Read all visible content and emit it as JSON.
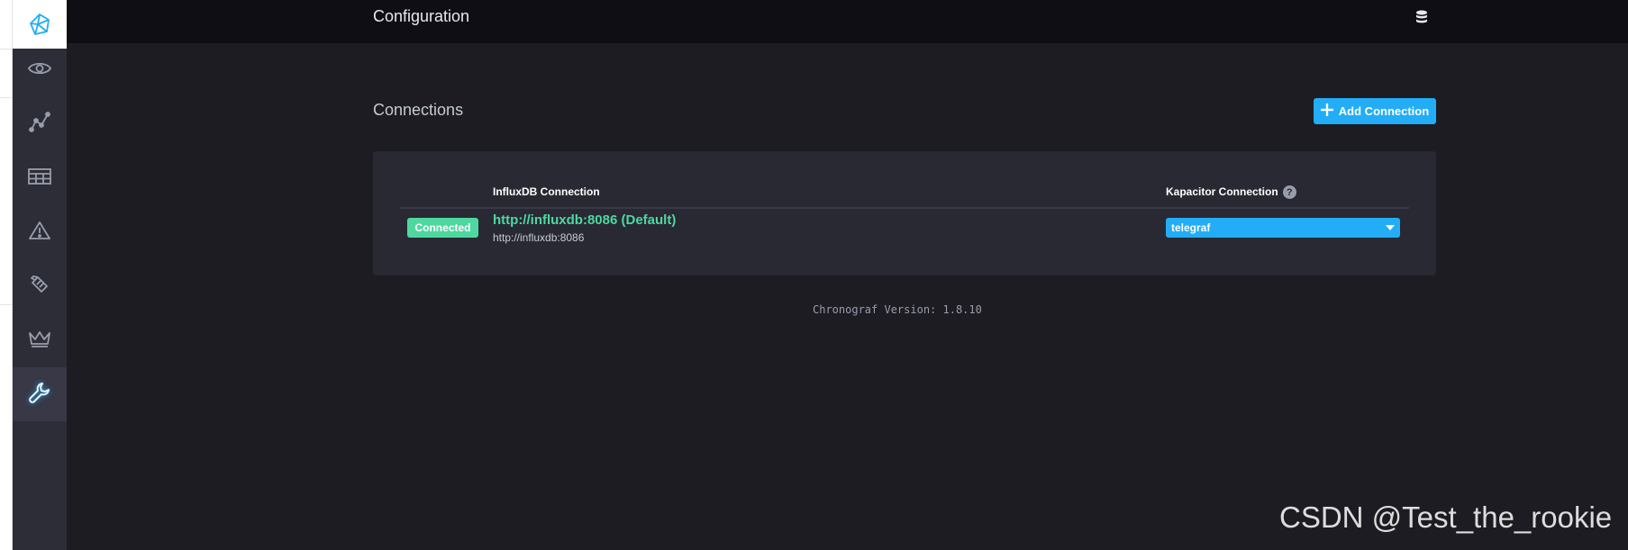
{
  "app": {
    "header_title": "Configuration",
    "section_title": "Connections",
    "add_button_label": "Add Connection",
    "version_text": "Chronograf Version: 1.8.10"
  },
  "sidebar": {
    "items": [
      {
        "icon": "eye-icon",
        "label": "Host List"
      },
      {
        "icon": "graph-icon",
        "label": "Data Explorer"
      },
      {
        "icon": "dashboard-grid-icon",
        "label": "Dashboards"
      },
      {
        "icon": "alert-triangle-icon",
        "label": "Alerting"
      },
      {
        "icon": "log-viewer-icon",
        "label": "Log Viewer"
      },
      {
        "icon": "crown-icon",
        "label": "Admin"
      },
      {
        "icon": "wrench-icon",
        "label": "Configuration",
        "active": true
      }
    ]
  },
  "connections_table": {
    "columns": [
      "InfluxDB Connection",
      "Kapacitor Connection"
    ],
    "rows": [
      {
        "status": "Connected",
        "name": "http://influxdb:8086 (Default)",
        "url": "http://influxdb:8086",
        "kapacitor": "telegraf"
      }
    ]
  },
  "watermark": "CSDN @Test_the_rookie",
  "colors": {
    "accent": "#22adf6",
    "success": "#4ed8a0",
    "header_bg": "#0f0e15",
    "page_bg": "#1c1c22",
    "panel_bg": "#292933",
    "sidebar_bg": "#2d2d37"
  }
}
